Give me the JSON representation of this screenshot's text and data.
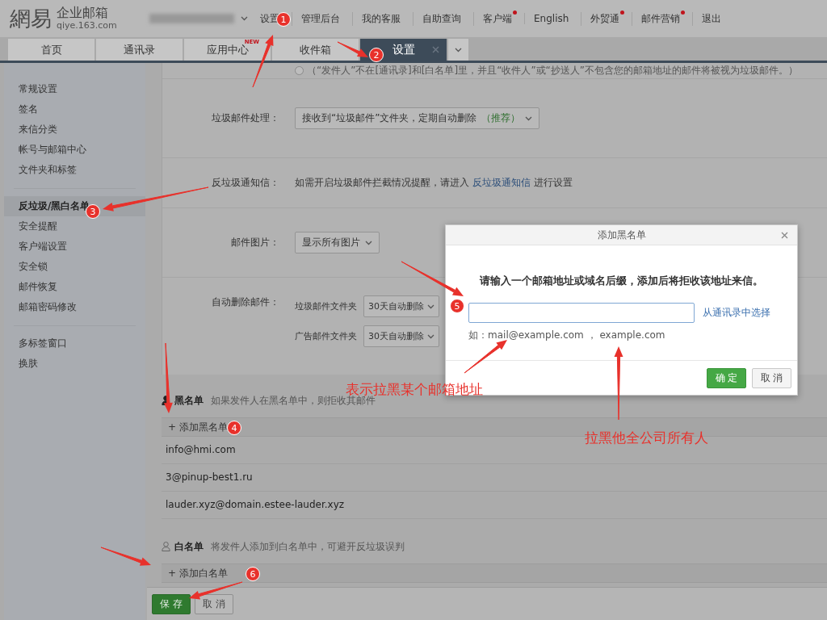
{
  "header": {
    "logo_mark": "網易",
    "logo_title": "企业邮箱",
    "logo_domain": "qiye.163.com",
    "nav": [
      {
        "label": "设置",
        "dot": false
      },
      {
        "label": "管理后台",
        "dot": false
      },
      {
        "label": "我的客服",
        "dot": false
      },
      {
        "label": "自助查询",
        "dot": false
      },
      {
        "label": "客户端",
        "dot": true
      },
      {
        "label": "English",
        "dot": false
      },
      {
        "label": "外贸通",
        "dot": true
      },
      {
        "label": "邮件营销",
        "dot": true
      },
      {
        "label": "退出",
        "dot": false
      }
    ]
  },
  "tabs": [
    {
      "label": "首页",
      "selected": false,
      "closable": false
    },
    {
      "label": "通讯录",
      "selected": false,
      "closable": false
    },
    {
      "label": "应用中心",
      "selected": false,
      "closable": false,
      "badge": "NEW"
    },
    {
      "label": "收件箱",
      "selected": false,
      "closable": false
    },
    {
      "label": "设置",
      "selected": true,
      "closable": true
    }
  ],
  "sidebar": {
    "groups": [
      [
        {
          "label": "常规设置",
          "selected": false
        },
        {
          "label": "签名",
          "selected": false
        },
        {
          "label": "来信分类",
          "selected": false
        },
        {
          "label": "帐号与邮箱中心",
          "selected": false
        },
        {
          "label": "文件夹和标签",
          "selected": false
        }
      ],
      [
        {
          "label": "反垃圾/黑白名单",
          "selected": true
        },
        {
          "label": "安全提醒",
          "selected": false
        },
        {
          "label": "客户端设置",
          "selected": false
        },
        {
          "label": "安全锁",
          "selected": false
        },
        {
          "label": "邮件恢复",
          "selected": false
        },
        {
          "label": "邮箱密码修改",
          "selected": false
        }
      ],
      [
        {
          "label": "多标签窗口",
          "selected": false
        },
        {
          "label": "换肤",
          "selected": false
        }
      ]
    ]
  },
  "settings": {
    "radio": {
      "text": "（“发件人”不在[通讯录]和[白名单]里，并且“收件人”或“抄送人”不包含您的邮箱地址的邮件将被视为垃圾邮件。）",
      "selected": false
    },
    "rows": [
      {
        "label": "垃圾邮件处理：",
        "kind": "select",
        "value": "接收到“垃圾邮件”文件夹，定期自动删除",
        "note": "（推荐）"
      },
      {
        "label": "反垃圾通知信：",
        "kind": "text",
        "before": "如需开启垃圾邮件拦截情况提醒，请进入",
        "link": "反垃圾通知信",
        "after": "进行设置"
      },
      {
        "label": "邮件图片：",
        "kind": "select",
        "value": "显示所有图片"
      },
      {
        "label": "自动删除邮件：",
        "kind": "subselects",
        "items": [
          {
            "label": "垃圾邮件文件夹",
            "value": "30天自动删除"
          },
          {
            "label": "广告邮件文件夹",
            "value": "30天自动删除"
          }
        ]
      }
    ]
  },
  "blacklist": {
    "title": "黑名单",
    "hint": "如果发件人在黑名单中，则拒收其邮件",
    "add": "+ 添加黑名单",
    "entries": [
      "info@hmi.com",
      "3@pinup-best1.ru",
      "lauder.xyz@domain.estee-lauder.xyz"
    ]
  },
  "whitelist": {
    "title": "白名单",
    "hint": "将发件人添加到白名单中，可避开反垃圾误判",
    "add": "+ 添加白名单"
  },
  "actions": [
    {
      "label": "保 存",
      "kind": "primary"
    },
    {
      "label": "取 消",
      "kind": "secondary"
    }
  ],
  "dialog": {
    "title": "添加黑名单",
    "prompt": "请输入一个邮箱地址或域名后缀，添加后将拒收该地址来信。",
    "pick_link": "从通讯录中选择",
    "example": "如：mail@example.com ， example.com",
    "buttons": [
      {
        "label": "确 定",
        "kind": "primary"
      },
      {
        "label": "取 消",
        "kind": "secondary"
      }
    ]
  },
  "annotations": {
    "markers": [
      "1",
      "2",
      "3",
      "4",
      "5",
      "6"
    ],
    "notes": [
      "表示拉黑某个邮箱地址",
      "拉黑他全公司所有人"
    ]
  }
}
